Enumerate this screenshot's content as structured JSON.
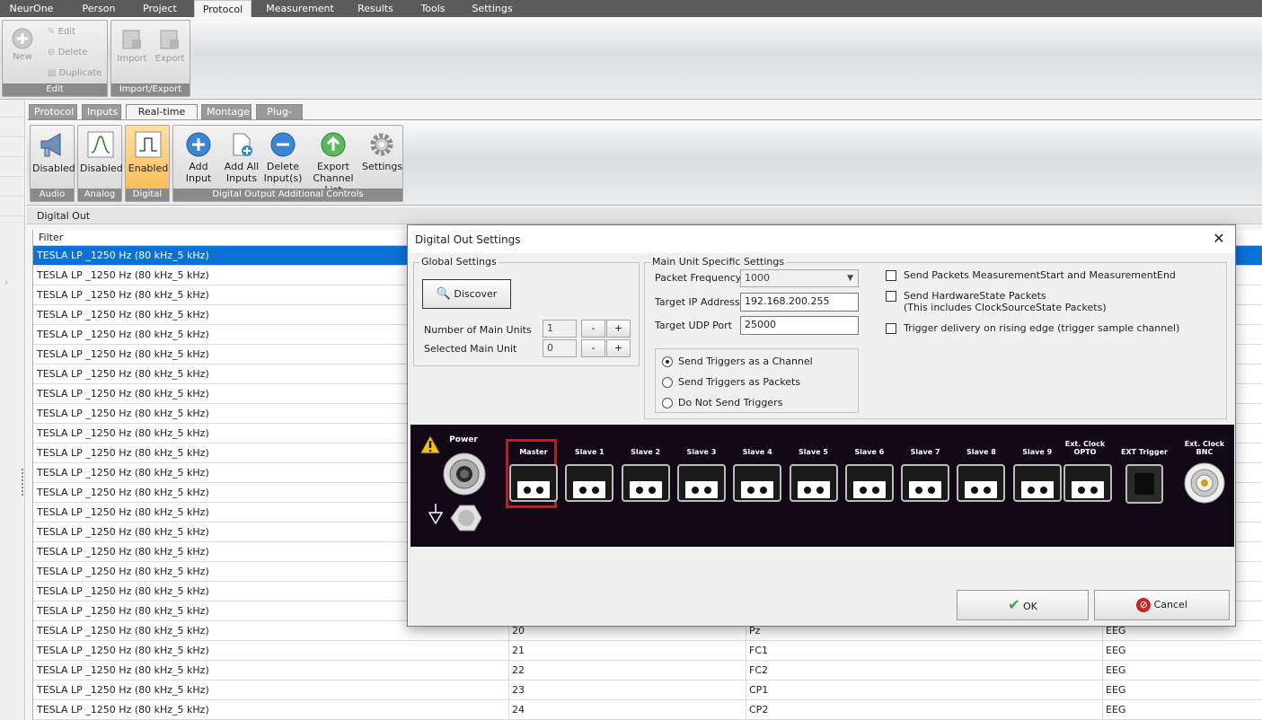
{
  "menubar": {
    "items": [
      "NeurOne",
      "Person",
      "Project",
      "Protocol",
      "Measurement",
      "Results",
      "Tools",
      "Settings"
    ],
    "active": "Protocol"
  },
  "ribbon": {
    "edit_group": {
      "title": "Edit",
      "new": "New",
      "edit": "Edit",
      "delete": "Delete",
      "duplicate": "Duplicate"
    },
    "import_export_group": {
      "title": "Import/Export",
      "import": "Import",
      "export": "Export"
    }
  },
  "subtabs": [
    "Protocol",
    "Inputs",
    "Real-time Out",
    "Montage",
    "Plug-ins"
  ],
  "subribbon": {
    "audio": {
      "label": "Disabled",
      "title": "Audio"
    },
    "analog": {
      "label": "Disabled",
      "title": "Analog"
    },
    "digital": {
      "label": "Enabled",
      "title": "Digital"
    },
    "controls": {
      "title": "Digital Output Additional Controls",
      "add_input": "Add Input",
      "add_all_1": "Add All",
      "add_all_2": "Inputs",
      "delete_1": "Delete",
      "delete_2": "Input(s)",
      "export_1": "Export",
      "export_2": "Channel List",
      "settings": "Settings"
    }
  },
  "digital_out": {
    "title": "Digital Out",
    "columns": [
      "Filter"
    ],
    "filter_value": "TESLA LP _1250 Hz (80 kHz_5 kHz)",
    "rows": [
      {
        "num": "",
        "name": "",
        "type": ""
      },
      {
        "num": "",
        "name": "",
        "type": ""
      },
      {
        "num": "",
        "name": "",
        "type": ""
      },
      {
        "num": "",
        "name": "",
        "type": ""
      },
      {
        "num": "",
        "name": "",
        "type": ""
      },
      {
        "num": "",
        "name": "",
        "type": ""
      },
      {
        "num": "",
        "name": "",
        "type": ""
      },
      {
        "num": "",
        "name": "",
        "type": ""
      },
      {
        "num": "",
        "name": "",
        "type": ""
      },
      {
        "num": "",
        "name": "",
        "type": ""
      },
      {
        "num": "",
        "name": "",
        "type": ""
      },
      {
        "num": "",
        "name": "",
        "type": ""
      },
      {
        "num": "",
        "name": "",
        "type": ""
      },
      {
        "num": "",
        "name": "",
        "type": ""
      },
      {
        "num": "",
        "name": "",
        "type": ""
      },
      {
        "num": "",
        "name": "",
        "type": ""
      },
      {
        "num": "",
        "name": "",
        "type": ""
      },
      {
        "num": "",
        "name": "",
        "type": ""
      },
      {
        "num": "",
        "name": "",
        "type": ""
      },
      {
        "num": "20",
        "name": "Pz",
        "type": "EEG"
      },
      {
        "num": "21",
        "name": "FC1",
        "type": "EEG"
      },
      {
        "num": "22",
        "name": "FC2",
        "type": "EEG"
      },
      {
        "num": "23",
        "name": "CP1",
        "type": "EEG"
      },
      {
        "num": "24",
        "name": "CP2",
        "type": "EEG"
      }
    ]
  },
  "dialog": {
    "title": "Digital Out Settings",
    "global": {
      "legend": "Global Settings",
      "discover": "Discover",
      "num_units_label": "Number of Main Units",
      "num_units_value": "1",
      "selected_unit_label": "Selected Main Unit",
      "selected_unit_value": "0",
      "minus": "-",
      "plus": "+"
    },
    "main_unit": {
      "legend": "Main Unit Specific Settings",
      "packet_freq_label": "Packet Frequency (Hz)",
      "packet_freq_value": "1000",
      "target_ip_label": "Target IP Address",
      "target_ip_value": "192.168.200.255",
      "udp_port_label": "Target UDP Port",
      "udp_port_value": "25000",
      "radio_channel": "Send Triggers as a Channel",
      "radio_packets": "Send Triggers as Packets",
      "radio_none": "Do Not Send Triggers"
    },
    "options": {
      "send_packets": "Send Packets MeasurementStart and MeasurementEnd",
      "send_hw_1": "Send HardwareState Packets",
      "send_hw_2": "(This includes ClockSourceState Packets)",
      "trigger_rising": "Trigger delivery on rising edge (trigger sample channel)"
    },
    "device": {
      "power": "Power",
      "ports": [
        "Master",
        "Slave 1",
        "Slave 2",
        "Slave 3",
        "Slave 4",
        "Slave 5",
        "Slave 6",
        "Slave 7",
        "Slave 8",
        "Slave 9"
      ],
      "ext_clock_opto_1": "Ext. Clock",
      "ext_clock_opto_2": "OPTO",
      "ext_trigger": "EXT Trigger",
      "ext_clock_bnc_1": "Ext. Clock",
      "ext_clock_bnc_2": "BNC"
    },
    "ok": "OK",
    "cancel": "Cancel"
  }
}
